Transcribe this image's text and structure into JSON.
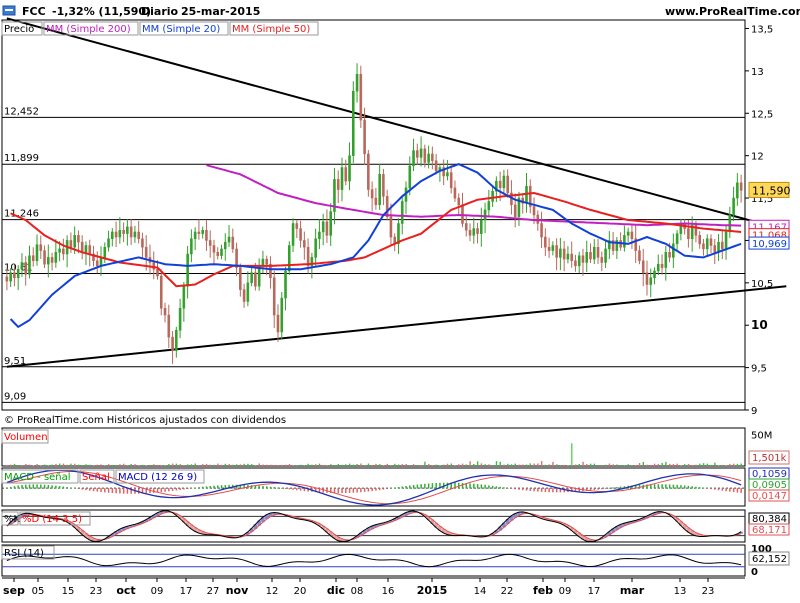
{
  "header": {
    "symbol": "FCC",
    "change": "-1,32% (11,590)",
    "period": "Diario",
    "date": "25-mar-2015",
    "site": "www.ProRealTime.com",
    "copyright": "© ProRealTime.com Históricos ajustados con dividendos"
  },
  "colors": {
    "background": "#ffffff",
    "candle_up": "#33a02c",
    "candle_down": "#b9675a",
    "sma200": "#c020c0",
    "sma20": "#1040d8",
    "sma50": "#e82020",
    "volume": "#3dbd3d",
    "label_fill_price": "#ffd75a",
    "panel_border": "#000000"
  },
  "chart_data": [
    {
      "panel": "price",
      "type": "candlestick",
      "legend": [
        {
          "label": "Precio",
          "color": "#000000"
        },
        {
          "label": "MM (Simple 200)",
          "color": "#c020c0"
        },
        {
          "label": "MM (Simple 20)",
          "color": "#1040d8"
        },
        {
          "label": "MM (Simple 50)",
          "color": "#e82020"
        }
      ],
      "ylim": [
        9,
        13.6
      ],
      "y_ticks": [
        {
          "value": 13.5,
          "label": "13,5"
        },
        {
          "value": 13,
          "label": "13"
        },
        {
          "value": 12.5,
          "label": "12,5"
        },
        {
          "value": 12,
          "label": "12"
        },
        {
          "value": 11.5,
          "label": "11,5"
        },
        {
          "value": 11,
          "label": "11"
        },
        {
          "value": 10.5,
          "label": "10,5"
        },
        {
          "value": 10,
          "label": "10"
        },
        {
          "value": 9.5,
          "label": "9,5"
        },
        {
          "value": 9,
          "label": "9"
        }
      ],
      "horizontal_levels": [
        {
          "value": 12.452,
          "label": "12,452"
        },
        {
          "value": 11.899,
          "label": "11,899"
        },
        {
          "value": 11.246,
          "label": "11,246"
        },
        {
          "value": 10.61,
          "label": "10,61"
        },
        {
          "value": 9.51,
          "label": "9,51"
        },
        {
          "value": 9.09,
          "label": "9,09"
        }
      ],
      "x_ticks": [
        "sep",
        "05",
        "15",
        "23",
        "oct",
        "09",
        "17",
        "27",
        "nov",
        "12",
        "20",
        "dic",
        "08",
        "16",
        "2015",
        "14",
        "22",
        "feb",
        "09",
        "17",
        "mar",
        "13",
        "23"
      ],
      "trendlines": [
        {
          "from": [
            0,
            13.62
          ],
          "to": [
            207,
            11.12
          ]
        },
        {
          "from": [
            0,
            9.51
          ],
          "to": [
            207,
            10.46
          ]
        }
      ],
      "close": [
        10.52,
        10.62,
        10.56,
        10.66,
        10.74,
        10.6,
        10.82,
        10.76,
        10.95,
        10.88,
        10.72,
        10.8,
        10.74,
        10.86,
        10.9,
        10.84,
        11.0,
        10.92,
        11.06,
        10.98,
        10.86,
        10.94,
        10.84,
        10.76,
        10.7,
        10.8,
        10.92,
        11.02,
        11.1,
        11.04,
        11.12,
        11.08,
        11.16,
        11.04,
        11.1,
        11.02,
        10.92,
        10.8,
        10.74,
        10.66,
        10.58,
        10.2,
        10.12,
        9.86,
        9.7,
        9.94,
        10.2,
        10.46,
        10.84,
        11.02,
        11.1,
        11.08,
        11.12,
        11.0,
        10.94,
        10.86,
        10.82,
        10.9,
        10.98,
        11.04,
        10.9,
        10.68,
        10.42,
        10.28,
        10.5,
        10.62,
        10.46,
        10.7,
        10.78,
        10.72,
        10.56,
        10.12,
        9.92,
        10.32,
        10.64,
        10.94,
        11.2,
        11.14,
        11.0,
        10.92,
        10.7,
        10.8,
        11.02,
        11.1,
        11.22,
        11.06,
        11.34,
        11.72,
        11.6,
        11.86,
        11.7,
        12.0,
        12.76,
        12.96,
        12.42,
        12.02,
        11.6,
        11.5,
        11.42,
        11.78,
        11.52,
        11.28,
        11.04,
        10.96,
        11.2,
        11.46,
        11.62,
        11.88,
        12.06,
        11.98,
        12.08,
        11.92,
        12.02,
        11.94,
        11.82,
        11.86,
        11.76,
        11.8,
        11.62,
        11.5,
        11.42,
        11.2,
        11.12,
        11.06,
        11.14,
        11.08,
        11.24,
        11.36,
        11.46,
        11.58,
        11.7,
        11.62,
        11.76,
        11.56,
        11.42,
        11.28,
        11.5,
        11.44,
        11.64,
        11.4,
        11.3,
        11.2,
        11.04,
        10.92,
        10.88,
        10.94,
        10.8,
        10.9,
        10.78,
        10.84,
        10.76,
        10.7,
        10.82,
        10.74,
        10.86,
        10.78,
        10.92,
        10.8,
        10.74,
        10.9,
        11.0,
        10.88,
        11.0,
        10.92,
        11.06,
        11.1,
        11.02,
        10.88,
        10.76,
        10.62,
        10.48,
        10.56,
        10.64,
        10.72,
        10.68,
        10.86,
        10.8,
        10.96,
        11.08,
        11.2,
        11.14,
        11.02,
        11.18,
        11.06,
        10.96,
        10.9,
        11.02,
        10.94,
        10.86,
        10.98,
        10.9,
        11.1,
        11.3,
        11.5,
        11.68,
        11.59
      ],
      "series": [
        {
          "name": "MM (Simple 200)",
          "color": "#c020c0",
          "label": "11,167",
          "anchors": [
            [
              52,
              11.9
            ],
            [
              62,
              11.78
            ],
            [
              72,
              11.56
            ],
            [
              82,
              11.44
            ],
            [
              92,
              11.36
            ],
            [
              100,
              11.3
            ],
            [
              110,
              11.28
            ],
            [
              120,
              11.3
            ],
            [
              130,
              11.28
            ],
            [
              140,
              11.24
            ],
            [
              150,
              11.22
            ],
            [
              160,
              11.2
            ],
            [
              170,
              11.18
            ],
            [
              180,
              11.2
            ],
            [
              190,
              11.18
            ],
            [
              200,
              11.17
            ]
          ]
        },
        {
          "name": "MM (Simple 50)",
          "color": "#e82020",
          "label": "11,068",
          "anchors": [
            [
              0,
              11.34
            ],
            [
              5,
              11.24
            ],
            [
              10,
              11.06
            ],
            [
              15,
              10.94
            ],
            [
              20,
              10.86
            ],
            [
              30,
              10.74
            ],
            [
              40,
              10.68
            ],
            [
              45,
              10.46
            ],
            [
              50,
              10.48
            ],
            [
              55,
              10.6
            ],
            [
              60,
              10.7
            ],
            [
              70,
              10.7
            ],
            [
              80,
              10.72
            ],
            [
              90,
              10.76
            ],
            [
              95,
              10.8
            ],
            [
              100,
              10.9
            ],
            [
              105,
              11.0
            ],
            [
              110,
              11.08
            ],
            [
              118,
              11.36
            ],
            [
              125,
              11.48
            ],
            [
              132,
              11.52
            ],
            [
              140,
              11.56
            ],
            [
              148,
              11.46
            ],
            [
              155,
              11.36
            ],
            [
              165,
              11.24
            ],
            [
              175,
              11.2
            ],
            [
              185,
              11.14
            ],
            [
              195,
              11.1
            ],
            [
              200,
              11.068
            ]
          ]
        },
        {
          "name": "MM (Simple 20)",
          "color": "#1040d8",
          "label": "10,969",
          "anchors": [
            [
              0,
              10.12
            ],
            [
              3,
              9.98
            ],
            [
              6,
              10.06
            ],
            [
              12,
              10.36
            ],
            [
              18,
              10.58
            ],
            [
              25,
              10.7
            ],
            [
              35,
              10.8
            ],
            [
              42,
              10.72
            ],
            [
              48,
              10.7
            ],
            [
              55,
              10.72
            ],
            [
              62,
              10.7
            ],
            [
              70,
              10.66
            ],
            [
              78,
              10.66
            ],
            [
              86,
              10.72
            ],
            [
              92,
              10.8
            ],
            [
              96,
              11.0
            ],
            [
              100,
              11.3
            ],
            [
              105,
              11.52
            ],
            [
              110,
              11.7
            ],
            [
              115,
              11.82
            ],
            [
              120,
              11.9
            ],
            [
              125,
              11.8
            ],
            [
              130,
              11.6
            ],
            [
              135,
              11.48
            ],
            [
              140,
              11.42
            ],
            [
              145,
              11.36
            ],
            [
              150,
              11.2
            ],
            [
              155,
              11.08
            ],
            [
              160,
              10.98
            ],
            [
              165,
              10.96
            ],
            [
              170,
              11.04
            ],
            [
              175,
              10.96
            ],
            [
              180,
              10.82
            ],
            [
              185,
              10.8
            ],
            [
              190,
              10.88
            ],
            [
              195,
              10.96
            ],
            [
              200,
              10.9
            ],
            [
              205,
              10.969
            ]
          ]
        }
      ],
      "last_price_label": "11,590"
    },
    {
      "panel": "volume",
      "type": "bar",
      "legend": [
        {
          "label": "Volumen",
          "color": "#ff0000"
        }
      ],
      "ylim": [
        0,
        60
      ],
      "y_ticks": [
        {
          "value": 50,
          "label": "50M"
        }
      ],
      "value_label": "1,501k",
      "spike": {
        "index": 150,
        "value": 36
      }
    },
    {
      "panel": "macd",
      "type": "line",
      "legend": [
        {
          "label": "MACD - señal",
          "color": "#00a000"
        },
        {
          "label": "Señal",
          "color": "#ff0000"
        },
        {
          "label": "MACD (12 26 9)",
          "color": "#0000c0"
        }
      ],
      "ylim": [
        -0.4,
        0.45
      ],
      "value_labels": [
        "0,1059",
        "0,0905",
        "0,0147"
      ]
    },
    {
      "panel": "stochastic",
      "type": "line",
      "legend": [
        {
          "label": "%K",
          "color": "#000000"
        },
        {
          "label": "%D (14 3 5)",
          "color": "#ff0000"
        }
      ],
      "ylim": [
        0,
        100
      ],
      "value_labels": [
        "80,384",
        "68,171"
      ]
    },
    {
      "panel": "rsi",
      "type": "line",
      "legend": [
        {
          "label": "RSI (14)",
          "color": "#000000"
        }
      ],
      "ylim": [
        0,
        100
      ],
      "y_ticks": [
        {
          "value": 100,
          "label": "100"
        },
        {
          "value": 0,
          "label": "0"
        }
      ],
      "value_label": "62,152"
    }
  ]
}
